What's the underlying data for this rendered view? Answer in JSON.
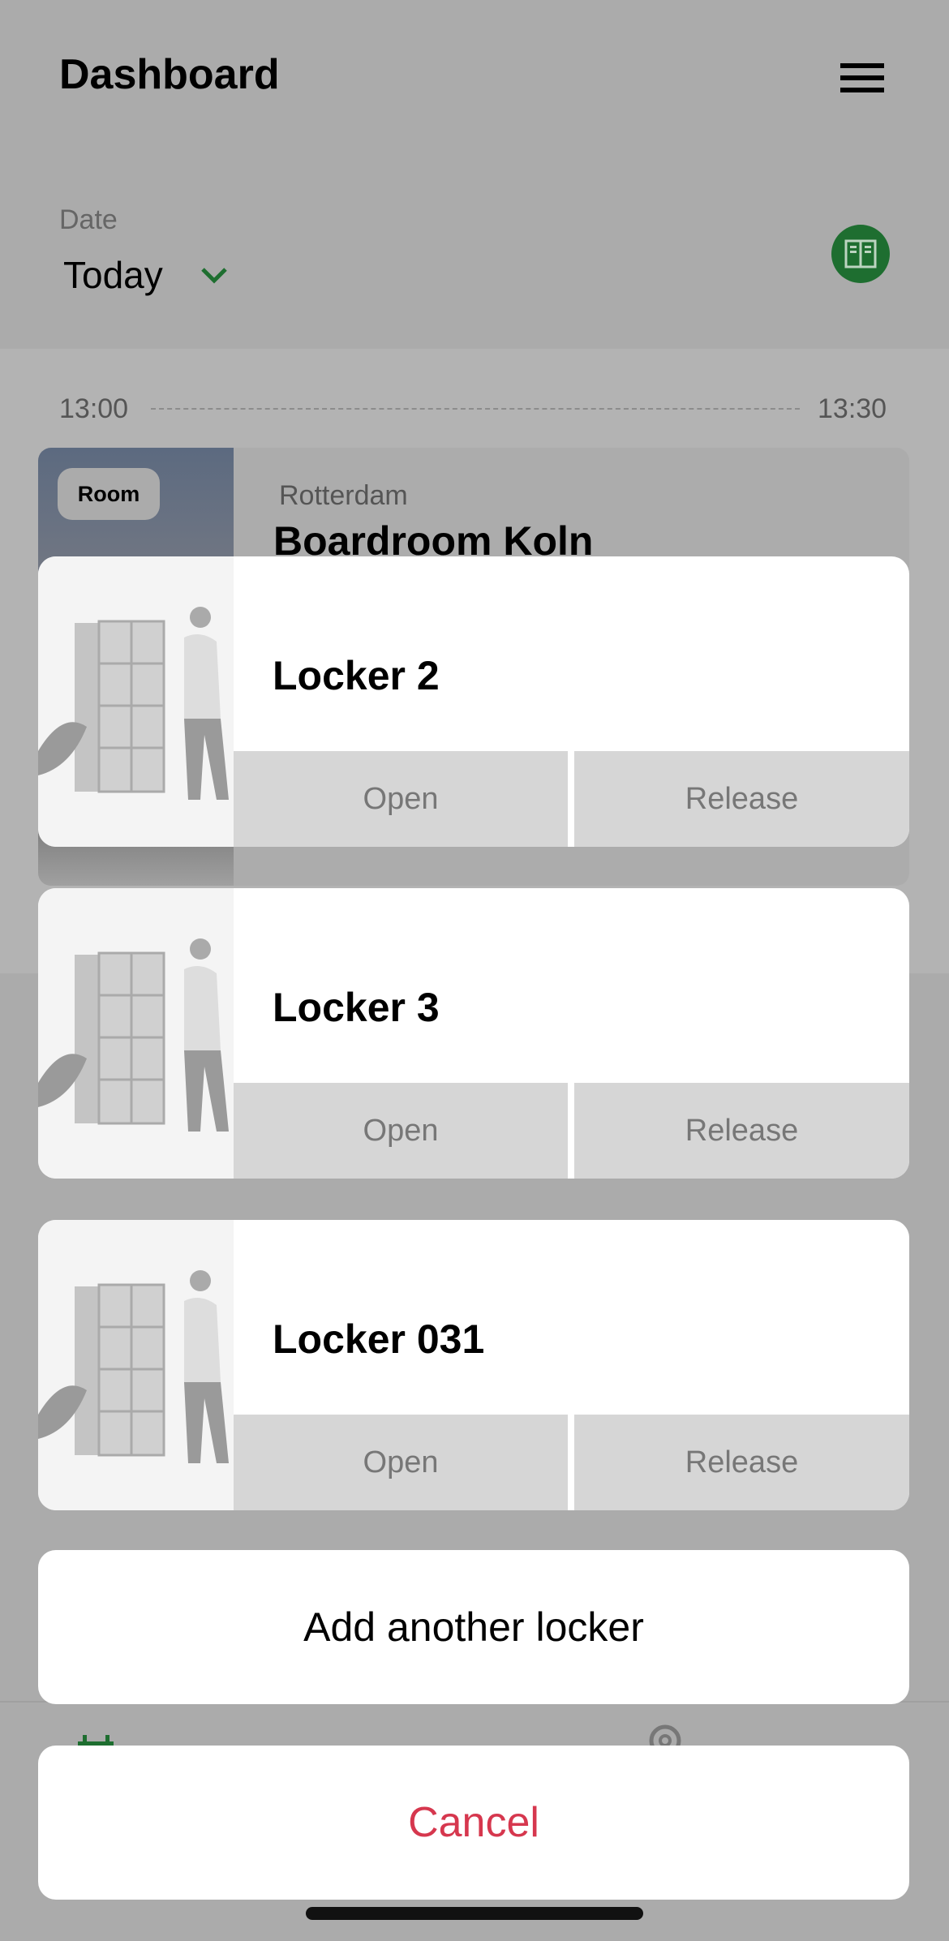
{
  "header": {
    "title": "Dashboard",
    "menu_icon": "hamburger-icon"
  },
  "date": {
    "label": "Date",
    "value": "Today",
    "dropdown_icon": "chevron-down-icon",
    "locker_icon": "locker-icon"
  },
  "timeline": {
    "start": "13:00",
    "end": "13:30"
  },
  "booking": {
    "badge": "Room",
    "city": "Rotterdam",
    "name": "Boardroom Koln"
  },
  "lockers": [
    {
      "name": "Locker 2",
      "open_label": "Open",
      "release_label": "Release"
    },
    {
      "name": "Locker 3",
      "open_label": "Open",
      "release_label": "Release"
    },
    {
      "name": "Locker 031",
      "open_label": "Open",
      "release_label": "Release"
    }
  ],
  "actions": {
    "add_label": "Add another locker",
    "cancel_label": "Cancel"
  },
  "colors": {
    "accent": "#1e6e30",
    "cancel": "#d6374e",
    "overlay": "#ababab"
  }
}
